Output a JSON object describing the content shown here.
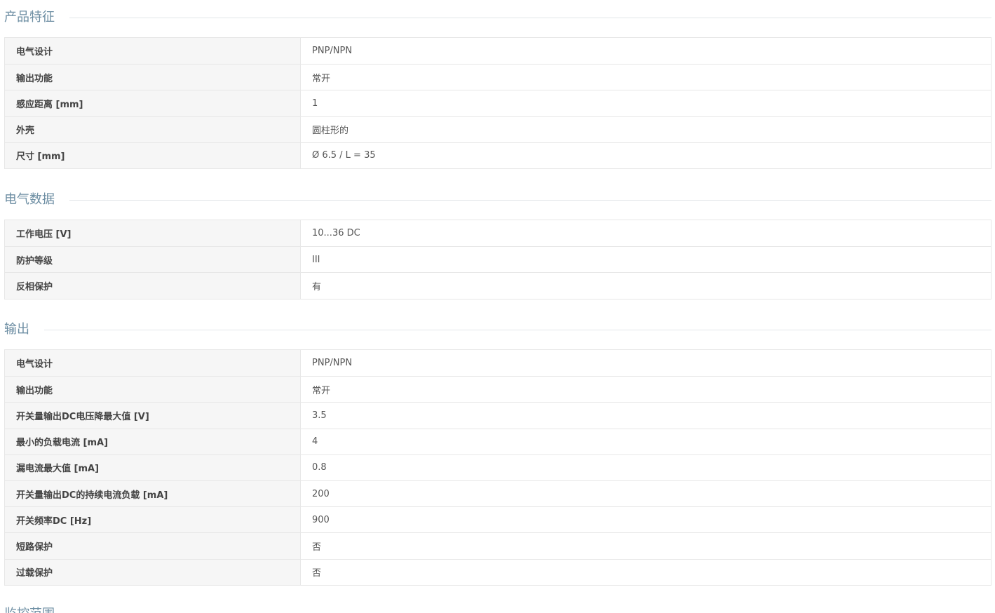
{
  "sections": [
    {
      "title": "产品特征",
      "rows": [
        {
          "label": "电气设计",
          "value": "PNP/NPN"
        },
        {
          "label": "输出功能",
          "value": "常开"
        },
        {
          "label": "感应距离 [mm]",
          "value": "1"
        },
        {
          "label": "外壳",
          "value": "圆柱形的"
        },
        {
          "label": "尺寸 [mm]",
          "value": "Ø 6.5 / L = 35"
        }
      ]
    },
    {
      "title": "电气数据",
      "rows": [
        {
          "label": "工作电压 [V]",
          "value": "10...36 DC"
        },
        {
          "label": "防护等级",
          "value": "III"
        },
        {
          "label": "反相保护",
          "value": "有"
        }
      ]
    },
    {
      "title": "输出",
      "rows": [
        {
          "label": "电气设计",
          "value": "PNP/NPN"
        },
        {
          "label": "输出功能",
          "value": "常开"
        },
        {
          "label": "开关量输出DC电压降最大值 [V]",
          "value": "3.5"
        },
        {
          "label": "最小的负载电流 [mA]",
          "value": "4"
        },
        {
          "label": "漏电流最大值 [mA]",
          "value": "0.8"
        },
        {
          "label": "开关量输出DC的持续电流负载 [mA]",
          "value": "200"
        },
        {
          "label": "开关频率DC [Hz]",
          "value": "900"
        },
        {
          "label": "短路保护",
          "value": "否"
        },
        {
          "label": "过载保护",
          "value": "否"
        }
      ]
    },
    {
      "title": "监控范围",
      "rows": []
    }
  ]
}
